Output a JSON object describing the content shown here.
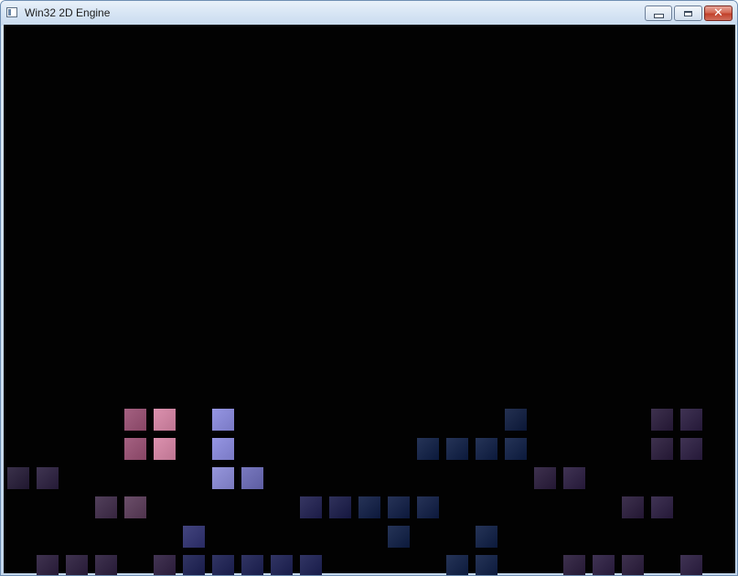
{
  "window": {
    "title": "Win32 2D Engine",
    "close_glyph": "✕"
  },
  "game": {
    "background_color": "#020202",
    "grid_cell_size": 32,
    "tiles": [
      {
        "col": 4,
        "row": 13,
        "color": "#9a4f73"
      },
      {
        "col": 5,
        "row": 13,
        "color": "#d885a6"
      },
      {
        "col": 7,
        "row": 13,
        "color": "#8a8ae0"
      },
      {
        "col": 17,
        "row": 13,
        "color": "#0c1a3e"
      },
      {
        "col": 22,
        "row": 13,
        "color": "#281a3a"
      },
      {
        "col": 23,
        "row": 13,
        "color": "#2a1c40"
      },
      {
        "col": 4,
        "row": 14,
        "color": "#9a4f73"
      },
      {
        "col": 5,
        "row": 14,
        "color": "#d885a6"
      },
      {
        "col": 7,
        "row": 14,
        "color": "#8a8ae0"
      },
      {
        "col": 14,
        "row": 14,
        "color": "#0d1d44"
      },
      {
        "col": 15,
        "row": 14,
        "color": "#0d1d44"
      },
      {
        "col": 16,
        "row": 14,
        "color": "#0d1d44"
      },
      {
        "col": 17,
        "row": 14,
        "color": "#0d1d44"
      },
      {
        "col": 22,
        "row": 14,
        "color": "#281a3a"
      },
      {
        "col": 23,
        "row": 14,
        "color": "#2a1c40"
      },
      {
        "col": 0,
        "row": 15,
        "color": "#241a36"
      },
      {
        "col": 1,
        "row": 15,
        "color": "#2a1e3e"
      },
      {
        "col": 7,
        "row": 15,
        "color": "#8a8ad8"
      },
      {
        "col": 8,
        "row": 15,
        "color": "#6a6ab8"
      },
      {
        "col": 18,
        "row": 15,
        "color": "#281a3a"
      },
      {
        "col": 19,
        "row": 15,
        "color": "#2a1c40"
      },
      {
        "col": 3,
        "row": 16,
        "color": "#3e2a48"
      },
      {
        "col": 4,
        "row": 16,
        "color": "#5a3a58"
      },
      {
        "col": 10,
        "row": 16,
        "color": "#1f1f50"
      },
      {
        "col": 11,
        "row": 16,
        "color": "#181a48"
      },
      {
        "col": 12,
        "row": 16,
        "color": "#0e1c44"
      },
      {
        "col": 13,
        "row": 16,
        "color": "#0e1c44"
      },
      {
        "col": 14,
        "row": 16,
        "color": "#0e1c44"
      },
      {
        "col": 21,
        "row": 16,
        "color": "#281a3a"
      },
      {
        "col": 22,
        "row": 16,
        "color": "#2a1c40"
      },
      {
        "col": 6,
        "row": 17,
        "color": "#2e3070"
      },
      {
        "col": 13,
        "row": 17,
        "color": "#0d1d44"
      },
      {
        "col": 16,
        "row": 17,
        "color": "#0d1d44"
      },
      {
        "col": 1,
        "row": 18,
        "color": "#2a1c3c"
      },
      {
        "col": 2,
        "row": 18,
        "color": "#2a1c3c"
      },
      {
        "col": 3,
        "row": 18,
        "color": "#2a1c3c"
      },
      {
        "col": 5,
        "row": 18,
        "color": "#2e1e40"
      },
      {
        "col": 6,
        "row": 18,
        "color": "#1a1e52"
      },
      {
        "col": 7,
        "row": 18,
        "color": "#1a1e52"
      },
      {
        "col": 8,
        "row": 18,
        "color": "#1a1e52"
      },
      {
        "col": 9,
        "row": 18,
        "color": "#1a1e52"
      },
      {
        "col": 10,
        "row": 18,
        "color": "#1a1e52"
      },
      {
        "col": 15,
        "row": 18,
        "color": "#0d1d44"
      },
      {
        "col": 16,
        "row": 18,
        "color": "#0d1d44"
      },
      {
        "col": 19,
        "row": 18,
        "color": "#281a3a"
      },
      {
        "col": 20,
        "row": 18,
        "color": "#2a1c40"
      },
      {
        "col": 21,
        "row": 18,
        "color": "#281a3a"
      },
      {
        "col": 23,
        "row": 18,
        "color": "#2a1c40"
      }
    ]
  }
}
